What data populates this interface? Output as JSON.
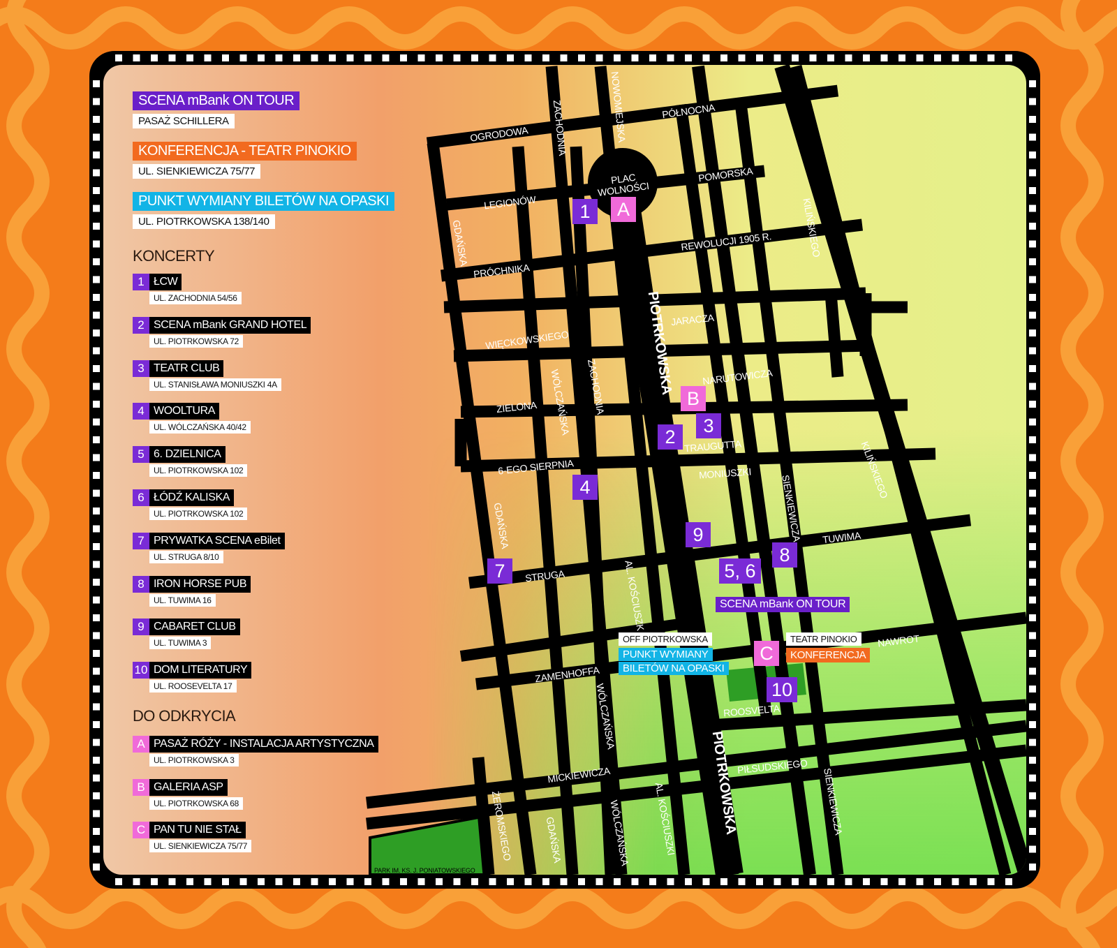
{
  "colors": {
    "purple": "#7a2bd6",
    "deep_purple": "#6a1fc9",
    "orange": "#f26a1f",
    "cyan": "#12b4e6",
    "pink": "#f06ad9",
    "road": "#000000",
    "park": "#2e9e25",
    "background": "#f58a1f"
  },
  "legend": {
    "sections": [
      {
        "title": "SCENA mBank ON TOUR",
        "address": "PASAŻ SCHILLERA",
        "color": "#6a1fc9"
      },
      {
        "title": "KONFERENCJA - TEATR PINOKIO",
        "address": "UL. SIENKIEWICZA 75/77",
        "color": "#f26a1f"
      },
      {
        "title": "PUNKT WYMIANY BILETÓW NA OPASKI",
        "address": "UL. PIOTRKOWSKA 138/140",
        "color": "#12b4e6"
      }
    ],
    "concerts_heading": "KONCERTY",
    "concerts": [
      {
        "num": "1",
        "name": "ŁCW",
        "address": "UL. ZACHODNIA 54/56"
      },
      {
        "num": "2",
        "name": "SCENA mBank GRAND HOTEL",
        "address": "UL. PIOTRKOWSKA 72"
      },
      {
        "num": "3",
        "name": "TEATR CLUB",
        "address": "UL. STANISŁAWA MONIUSZKI 4A"
      },
      {
        "num": "4",
        "name": "WOOLTURA",
        "address": "UL. WÓLCZAŃSKA 40/42"
      },
      {
        "num": "5",
        "name": "6. DZIELNICA",
        "address": "UL. PIOTRKOWSKA 102"
      },
      {
        "num": "6",
        "name": "ŁÓDŹ KALISKA",
        "address": "UL. PIOTRKOWSKA 102"
      },
      {
        "num": "7",
        "name": "PRYWATKA SCENA eBilet",
        "address": "UL. STRUGA 8/10"
      },
      {
        "num": "8",
        "name": "IRON HORSE PUB",
        "address": "UL. TUWIMA 16"
      },
      {
        "num": "9",
        "name": "CABARET CLUB",
        "address": "UL. TUWIMA 3"
      },
      {
        "num": "10",
        "name": "DOM LITERATURY",
        "address": "UL. ROOSEVELTA 17"
      }
    ],
    "discover_heading": "DO ODKRYCIA",
    "discover": [
      {
        "num": "A",
        "name": "PASAŻ RÓŻY - INSTALACJA ARTYSTYCZNA",
        "address": "UL. PIOTRKOWSKA 3"
      },
      {
        "num": "B",
        "name": "GALERIA ASP",
        "address": "UL. PIOTRKOWSKA 68"
      },
      {
        "num": "C",
        "name": "PAN TU NIE STAŁ",
        "address": "UL. SIENKIEWICZA 75/77"
      }
    ]
  },
  "streets": {
    "ogrodowa": "OGRODOWA",
    "zachodnia": "ZACHODNIA",
    "nowomiejska": "NOWOMIEJSKA",
    "polnocna": "PÓŁNOCNA",
    "plac": "PLAC",
    "wolnosci": "WOLNOŚCI",
    "pomorska": "POMORSKA",
    "legionow": "LEGIONÓW",
    "kilinskiego": "KILIŃSKIEGO",
    "gdanska": "GDAŃSKA",
    "rewolucji": "REWOLUCJI 1905 R.",
    "prochnika": "PRÓCHNIKA",
    "piotrkowska": "PIOTRKOWSKA",
    "jaracza": "JARACZA",
    "wieckowskiego": "WIĘCKOWSKIEGO",
    "wolczanska": "WÓLCZAŃSKA",
    "narutowicza": "NARUTOWICZA",
    "zielona": "ZIELONA",
    "traugutta": "TRAUGUTTA",
    "sierpnia": "6-EGO SIERPNIA",
    "moniuszki": "MONIUSZKI",
    "sienkiewicza": "SIENKIEWICZA",
    "tuwima": "TUWIMA",
    "struga": "STRUGA",
    "kosciuszki_short": "AL. KOŚCIUSZK",
    "kosciuszki": "AL. KOŚCIUSZKI",
    "nawrot": "NAWROT",
    "zamenhoffa": "ZAMENHOFFA",
    "roosvelta": "ROOSVELTA",
    "pilsudskiego": "PIŁSUDSKIEGO",
    "mickiewicza": "MICKIEWICZA",
    "zeromskiego": "ŻEROMSKIEGO",
    "park": "PARK IM. KS. J. PONIATOWSKIEGO"
  },
  "pins": {
    "p1": "1",
    "pA": "A",
    "pB": "B",
    "p3": "3",
    "p2": "2",
    "p4": "4",
    "p9": "9",
    "p8": "8",
    "p56": "5, 6",
    "p7": "7",
    "pC": "C",
    "p10": "10"
  },
  "map_tags": {
    "scena_tour": "SCENA mBank ON TOUR",
    "off": "OFF PIOTRKOWSKA",
    "punkt_1": "PUNKT WYMIANY",
    "punkt_2": "BILETÓW NA OPASKI",
    "teatr": "TEATR PINOKIO",
    "konferencja": "KONFERENCJA"
  }
}
